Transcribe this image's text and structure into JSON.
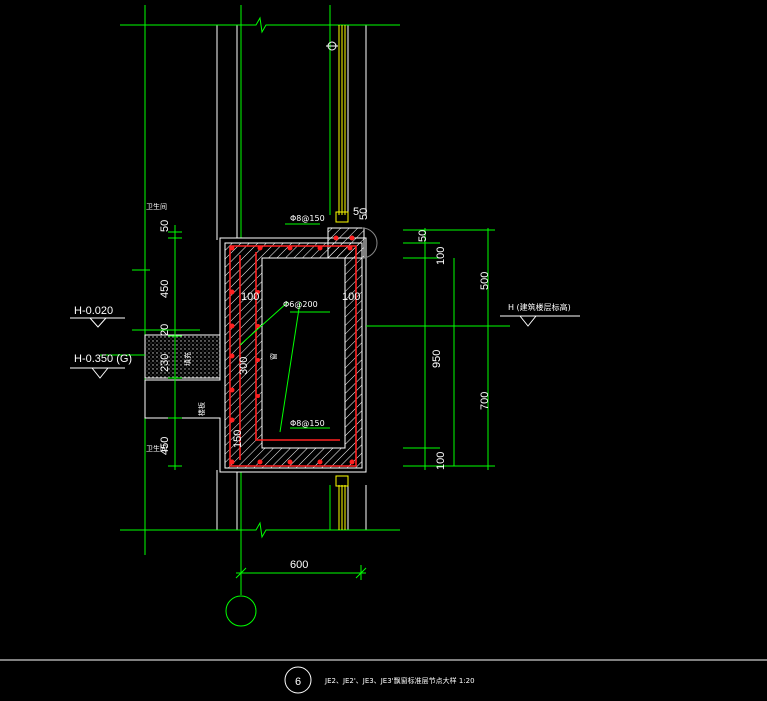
{
  "drawing": {
    "background": "#000000",
    "colors": {
      "dimension": "#00ff00",
      "outline": "#ffffff",
      "rebar": "#ff2020",
      "glass": "#ffff00",
      "axis": "#00ff00"
    }
  },
  "labels": {
    "room_upper": "卫生间",
    "room_lower": "卫生间",
    "rebar_top": "Φ8@150",
    "rebar_mid": "Φ6@200",
    "rebar_bottom": "Φ8@150",
    "slab_cover_left": "100",
    "slab_cover_right": "100",
    "inner_height": "300",
    "bottom_thk": "150",
    "fill_note": "填充",
    "board_note": "楼板",
    "inside_note": "窗",
    "dim_5": "5",
    "dim_50": "50"
  },
  "left_dims": {
    "d1": "50",
    "d2": "450",
    "d3": "20",
    "d4": "230",
    "d5": "450"
  },
  "right_dims": {
    "d1": "50",
    "d2": "100",
    "d3": "500",
    "d4": "950",
    "d5": "700",
    "d6": "100"
  },
  "bottom_dim": "600",
  "elevations": {
    "e1": "H-0.020",
    "e2": "H-0.350 (G)",
    "e3": "H (建筑楼层标高)"
  },
  "footer": {
    "number": "6",
    "title": "JE2、JE2'、JE3、JE3'飘窗标准层节点大样 1:20"
  }
}
